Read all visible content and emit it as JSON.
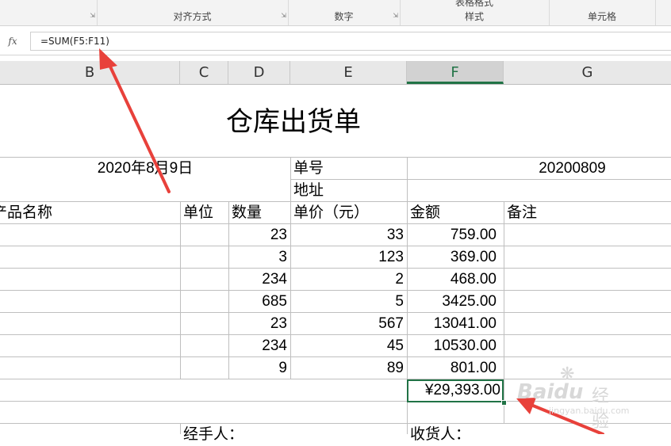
{
  "ribbon": {
    "groups": [
      "对齐方式",
      "数字",
      "样式",
      "单元格"
    ],
    "cut_label": "表格格式"
  },
  "formula_bar": {
    "fx": "fx",
    "formula": "=SUM(F5:F11)"
  },
  "columns": [
    "B",
    "C",
    "D",
    "E",
    "F",
    "G"
  ],
  "selected_column": "F",
  "sheet": {
    "title": "仓库出货单",
    "date": "2020年8月9日",
    "order_no_label": "单号",
    "order_no": "20200809",
    "address_label": "地址",
    "headers": {
      "product": "产品名称",
      "unit": "单位",
      "qty": "数量",
      "price": "单价（元）",
      "amount": "金额",
      "remark": "备注"
    },
    "rows": [
      {
        "qty": "23",
        "price": "33",
        "amount": "759.00"
      },
      {
        "qty": "3",
        "price": "123",
        "amount": "369.00"
      },
      {
        "qty": "234",
        "price": "2",
        "amount": "468.00"
      },
      {
        "qty": "685",
        "price": "5",
        "amount": "3425.00"
      },
      {
        "qty": "23",
        "price": "567",
        "amount": "13041.00"
      },
      {
        "qty": "234",
        "price": "45",
        "amount": "10530.00"
      },
      {
        "qty": "9",
        "price": "89",
        "amount": "801.00"
      }
    ],
    "total": "¥29,393.00",
    "handler_label": "经手人：",
    "receiver_label": "收货人："
  },
  "colors": {
    "accent": "#217346",
    "arrow": "#e8413b"
  },
  "watermark": {
    "brand": "Baidu",
    "text": "经验",
    "url": "jingyan.baidu.com"
  }
}
